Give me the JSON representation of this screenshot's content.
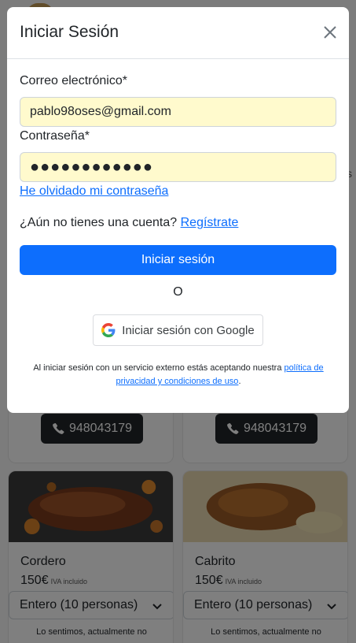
{
  "modal": {
    "title": "Iniciar Sesión",
    "email_label": "Correo electrónico*",
    "email_value": "pablo98oses@gmail.com",
    "password_label": "Contraseña*",
    "password_dots": "●●●●●●●●●●●●",
    "forgot_link": "He olvidado mi contraseña",
    "no_account_text": "¿Aún no tienes una cuenta?",
    "register_link": "Regístrate",
    "submit_label": "Iniciar sesión",
    "or_text": "O",
    "google_label": "Iniciar sesión con Google",
    "disclaimer_text": "Al iniciar sesión con un servicio externo estás aceptando nuestra",
    "disclaimer_link": "política de privacidad y condiciones de uso",
    "disclaimer_end": "."
  },
  "background": {
    "side_letter": "s",
    "phone_a": "948043179",
    "phone_b": "948043179",
    "products": [
      {
        "name": "Cordero",
        "price": "150€",
        "tax_note": "IVA incluido",
        "select_value": "Entero (10 personas)",
        "note": "Lo sentimos, actualmente no"
      },
      {
        "name": "Cabrito",
        "price": "150€",
        "tax_note": "IVA incluido",
        "select_value": "Entero (10 personas)",
        "note": "Lo sentimos, actualmente no"
      }
    ]
  },
  "colors": {
    "primary": "#0d6efd",
    "autofill": "#fffacd",
    "dark_button": "#212529"
  }
}
